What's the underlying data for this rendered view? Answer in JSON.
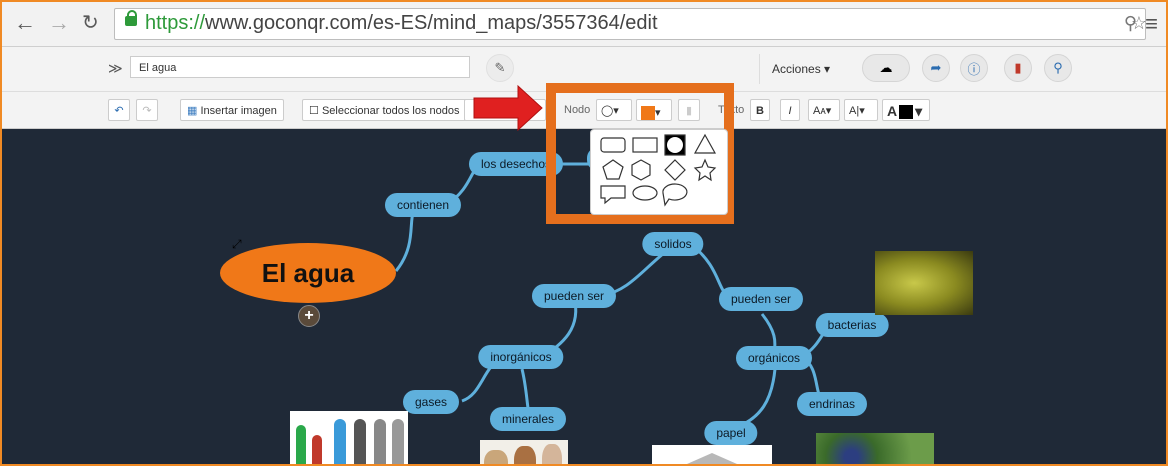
{
  "browser": {
    "url_scheme": "https://",
    "url_rest": "www.goconqr.com/es-ES/mind_maps/3557364/edit",
    "back_icon": "arrow-left-icon",
    "forward_icon": "arrow-right-icon",
    "reload_icon": "reload-icon"
  },
  "toolbar": {
    "title_value": "El agua",
    "acciones_label": "Acciones",
    "insert_image_label": "Insertar imagen",
    "select_all_label": "Seleccionar todos los nodos",
    "node_label": "Nodo",
    "text_label": "Texto",
    "bold_label": "B",
    "italic_label": "I",
    "size_label": "Aᴀ",
    "align_label": "A|",
    "color_label": "A",
    "node_color": "#f07818"
  },
  "map": {
    "root": "El agua",
    "nodes": {
      "contienen": "contienen",
      "desechos": "los desechos",
      "solidos": "solidos",
      "pueden1": "pueden ser",
      "pueden2": "pueden ser",
      "inorganicos": "inorgánicos",
      "organicos": "orgánicos",
      "gases": "gases",
      "minerales": "minerales",
      "papel": "papel",
      "bacterias": "bacterias",
      "endrinas": "endrinas"
    }
  },
  "colors": {
    "canvas": "#1f2937",
    "node": "#5fb0dc",
    "root": "#f07818",
    "highlight": "#e56f1d",
    "arrow": "#e02020"
  }
}
